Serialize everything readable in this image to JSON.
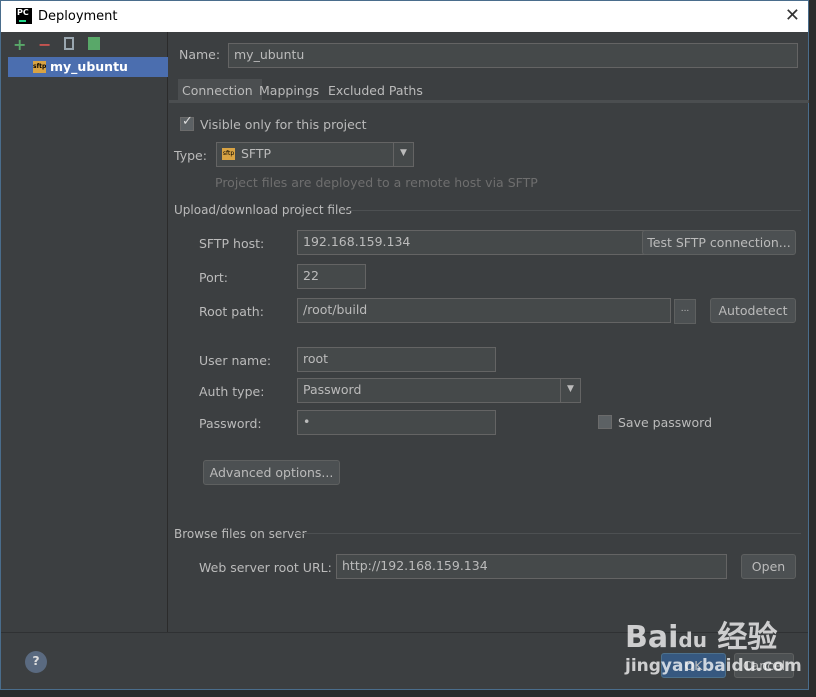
{
  "window": {
    "title": "Deployment",
    "close": "✕"
  },
  "sidebar": {
    "toolbar": [
      "add-icon",
      "remove-icon",
      "copy-icon",
      "default-icon"
    ],
    "items": [
      {
        "label": "my_ubuntu",
        "icon": "sftp-icon",
        "selected": true
      }
    ]
  },
  "name": {
    "label": "Name:",
    "value": "my_ubuntu"
  },
  "tabs": [
    {
      "label": "Connection",
      "active": true
    },
    {
      "label": "Mappings"
    },
    {
      "label": "Excluded Paths"
    }
  ],
  "connection": {
    "visible_only": {
      "label": "Visible only for this project",
      "checked": true
    },
    "type": {
      "label": "Type:",
      "value": "SFTP",
      "hint": "Project files are deployed to a remote host via SFTP"
    },
    "upload_section": "Upload/download project files",
    "host": {
      "label": "SFTP host:",
      "value": "192.168.159.134",
      "button": "Test SFTP connection..."
    },
    "port": {
      "label": "Port:",
      "value": "22"
    },
    "root": {
      "label": "Root path:",
      "value": "/root/build",
      "browse": "...",
      "button": "Autodetect"
    },
    "user": {
      "label": "User name:",
      "value": "root"
    },
    "auth": {
      "label": "Auth type:",
      "value": "Password"
    },
    "password": {
      "label": "Password:",
      "value": "•",
      "save_label": "Save password",
      "save_checked": false
    },
    "advanced": "Advanced options...",
    "browse_section": "Browse files on server",
    "web": {
      "label": "Web server root URL:",
      "value": "http://192.168.159.134",
      "button": "Open"
    }
  },
  "footer": {
    "help": "?",
    "ok": "OK",
    "cancel": "Cancel"
  },
  "watermark": "Baidu经验 jingyan.baidu.com"
}
